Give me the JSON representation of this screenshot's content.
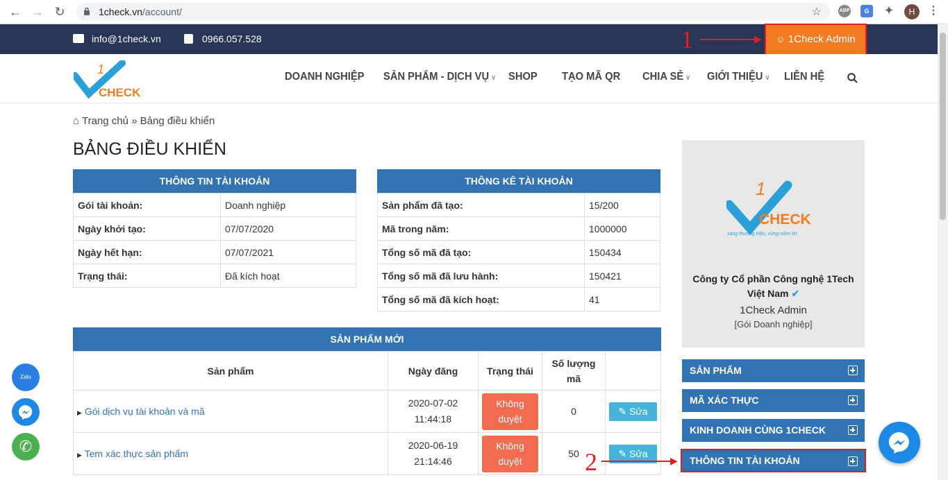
{
  "browser": {
    "url_domain": "1check.vn",
    "url_path": "/account/",
    "ext_abp": "ABP",
    "profile_initial": "H"
  },
  "topbar": {
    "email": "info@1check.vn",
    "phone": "0966.057.528",
    "admin_button": "1Check Admin"
  },
  "nav": {
    "logo_text": "CHECK",
    "logo_number": "1",
    "items": [
      "DOANH NGHIỆP",
      "SẢN PHẨM - DỊCH VỤ",
      "SHOP",
      "TẠO MÃ QR",
      "CHIA SẺ",
      "GIỚI THIỆU",
      "LIÊN HỆ"
    ]
  },
  "breadcrumb": {
    "home": "Trang chủ",
    "sep": "»",
    "current": "Bảng điều khiển"
  },
  "page_title": "BẢNG ĐIỀU KHIỂN",
  "account_info": {
    "title": "THÔNG TIN TÀI KHOẢN",
    "rows": [
      {
        "k": "Gói tài khoản:",
        "v": "Doanh nghiệp"
      },
      {
        "k": "Ngày khởi tạo:",
        "v": "07/07/2020"
      },
      {
        "k": "Ngày hết hạn:",
        "v": "07/07/2021"
      },
      {
        "k": "Trạng thái:",
        "v": "Đã kích hoạt"
      }
    ]
  },
  "account_stats": {
    "title": "THÔNG KÊ TÀI KHOẢN",
    "rows": [
      {
        "k": "Sản phẩm đã tạo:",
        "v": "15/200"
      },
      {
        "k": "Mã trong năm:",
        "v": "1000000"
      },
      {
        "k": "Tổng số mã đã tạo:",
        "v": "150434"
      },
      {
        "k": "Tổng số mã đã lưu hành:",
        "v": "150421"
      },
      {
        "k": "Tổng số mã đã kích hoạt:",
        "v": "41"
      }
    ]
  },
  "new_products": {
    "title": "SẢN PHẨM MỚI",
    "headers": [
      "Sản phẩm",
      "Ngày đăng",
      "Trạng thái",
      "Số lượng mã",
      ""
    ],
    "rows": [
      {
        "name": "Gói dịch vụ tài khoản và mã",
        "date": "2020-07-02",
        "time": "11:44:18",
        "status_1": "Không",
        "status_2": "duyệt",
        "qty": "0",
        "action": "Sửa"
      },
      {
        "name": "Tem xác thực sản phẩm",
        "date": "2020-06-19",
        "time": "21:14:46",
        "status_1": "Không",
        "status_2": "duyệt",
        "qty": "50",
        "action": "Sửa"
      }
    ]
  },
  "sidebar": {
    "logo_tagline": "sáng thương hiệu, vững niềm tin",
    "company_1": "Công ty Cổ phần Công nghệ 1Tech",
    "company_2": "Việt Nam",
    "user": "1Check Admin",
    "plan": "[Gói Doanh nghiệp]",
    "menu": [
      "SẢN PHẨM",
      "MÃ XÁC THỰC",
      "KINH DOANH CÙNG 1CHECK",
      "THÔNG TIN TÀI KHOẢN"
    ]
  },
  "annotations": {
    "one": "1",
    "two": "2"
  },
  "floating": {
    "zalo": "Zalo"
  },
  "colors": {
    "navy": "#283557",
    "orange": "#f47b20",
    "blue": "#3273b3",
    "red": "#e02020"
  }
}
